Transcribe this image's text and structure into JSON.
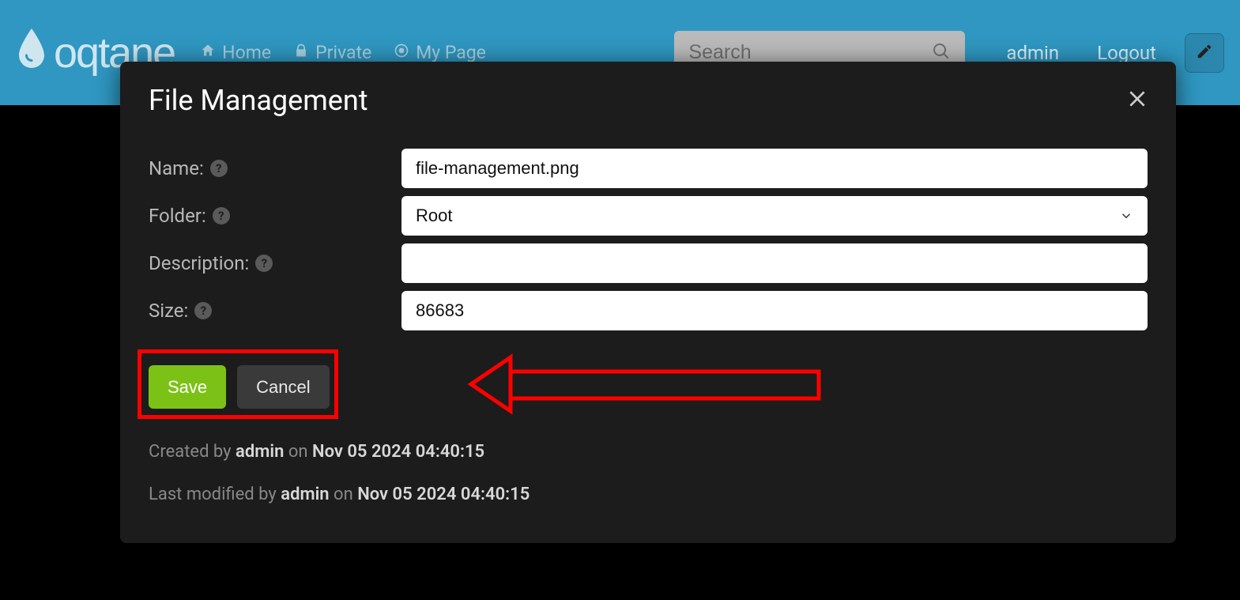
{
  "logo_text": "oqtane",
  "nav": {
    "home": "Home",
    "private": "Private",
    "mypage": "My Page"
  },
  "search": {
    "placeholder": "Search"
  },
  "user": {
    "name": "admin",
    "logout": "Logout"
  },
  "modal": {
    "title": "File Management",
    "labels": {
      "name": "Name:",
      "folder": "Folder:",
      "description": "Description:",
      "size": "Size:"
    },
    "fields": {
      "name": "file-management.png",
      "folder": "Root",
      "description": "",
      "size": "86683"
    },
    "buttons": {
      "save": "Save",
      "cancel": "Cancel"
    },
    "meta": {
      "created_prefix": "Created by ",
      "created_by": "admin",
      "created_on_word": " on ",
      "created_on": "Nov 05 2024 04:40:15",
      "modified_prefix": "Last modified by ",
      "modified_by": "admin",
      "modified_on_word": " on ",
      "modified_on": "Nov 05 2024 04:40:15"
    }
  }
}
